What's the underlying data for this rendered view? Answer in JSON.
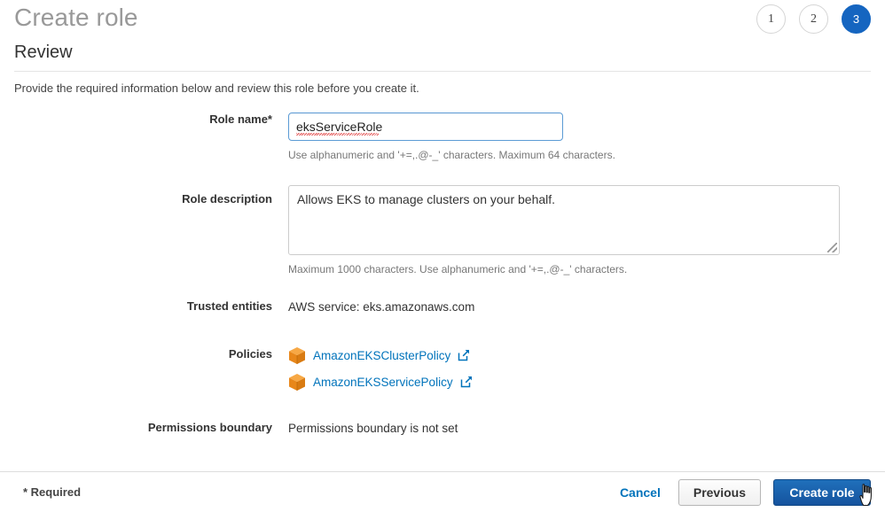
{
  "header": {
    "title": "Create role",
    "steps": [
      {
        "label": "1",
        "active": false
      },
      {
        "label": "2",
        "active": false
      },
      {
        "label": "3",
        "active": true
      }
    ]
  },
  "section": {
    "title": "Review",
    "intro": "Provide the required information below and review this role before you create it."
  },
  "form": {
    "role_name": {
      "label": "Role name*",
      "value": "eksServiceRole",
      "placeholder": "",
      "hint": "Use alphanumeric and '+=,.@-_' characters. Maximum 64 characters."
    },
    "role_description": {
      "label": "Role description",
      "value": "Allows EKS to manage clusters on your behalf.",
      "placeholder": "",
      "hint": "Maximum 1000 characters. Use alphanumeric and '+=,.@-_' characters."
    },
    "trusted_entities": {
      "label": "Trusted entities",
      "value": "AWS service: eks.amazonaws.com"
    },
    "policies": {
      "label": "Policies",
      "items": [
        {
          "name": "AmazonEKSClusterPolicy",
          "icon": "policy-cube-icon",
          "external_icon": "external-link-icon"
        },
        {
          "name": "AmazonEKSServicePolicy",
          "icon": "policy-cube-icon",
          "external_icon": "external-link-icon"
        }
      ]
    },
    "permissions_boundary": {
      "label": "Permissions boundary",
      "value": "Permissions boundary is not set"
    }
  },
  "footer": {
    "required_note": "* Required",
    "cancel_label": "Cancel",
    "previous_label": "Previous",
    "create_label": "Create role"
  },
  "colors": {
    "accent_blue": "#1565C0",
    "link_blue": "#0073bb",
    "primary_button": "#15539e",
    "policy_orange": "#f29111",
    "focus_border": "#5b9bd5"
  }
}
